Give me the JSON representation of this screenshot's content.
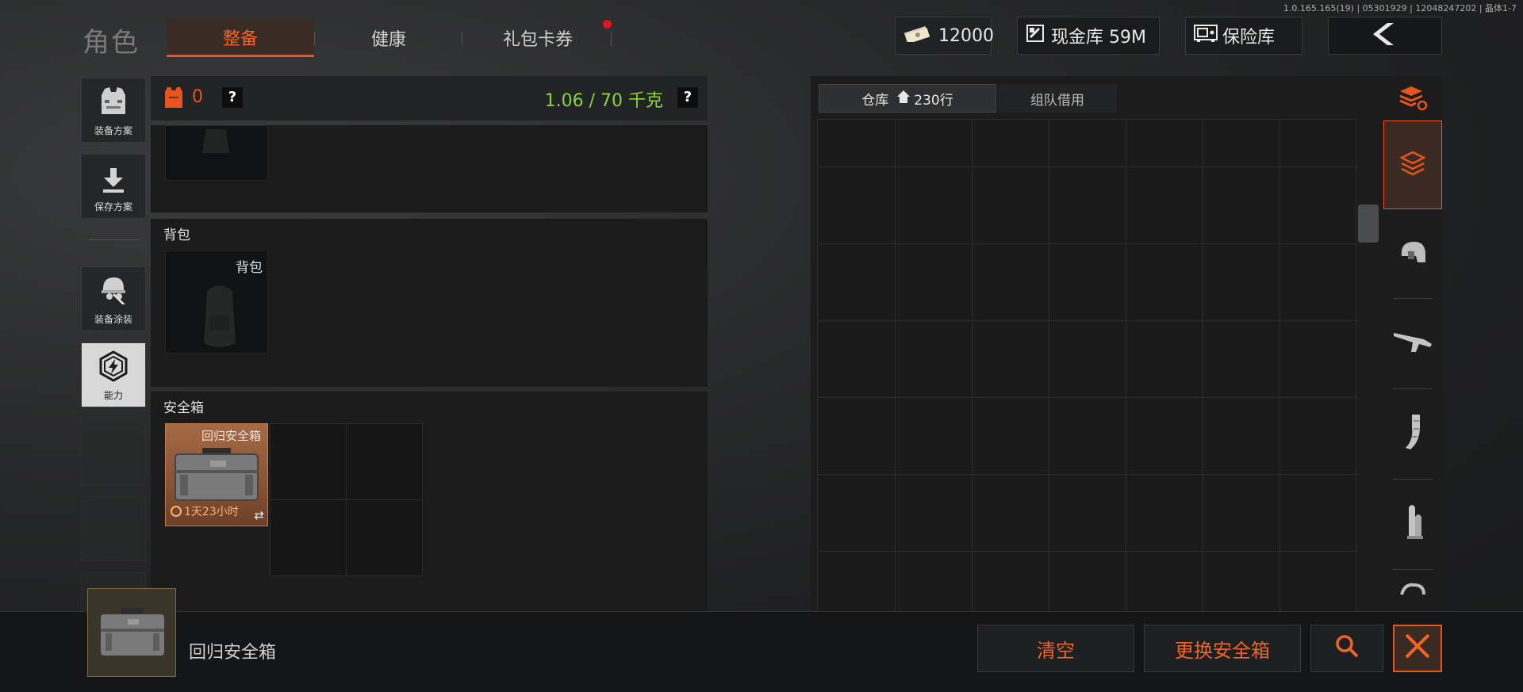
{
  "version": "1.0.165.165(19) | 05301929 | 12048247202 | 晶体1-7",
  "header": {
    "title": "角色",
    "tabs": [
      {
        "label": "整备",
        "active": true
      },
      {
        "label": "健康",
        "active": false
      },
      {
        "label": "礼包卡券",
        "active": false,
        "notification": true
      }
    ],
    "currency": {
      "icon": "cash-icon",
      "value": "12000"
    },
    "cash_vault": {
      "icon": "vault-icon",
      "label": "现金库 59M"
    },
    "safe_vault": {
      "icon": "safe-icon",
      "label": "保险库"
    },
    "back_icon": "chevron-left-icon"
  },
  "sidebar": {
    "items": [
      {
        "label": "装备方案",
        "icon": "vest-icon"
      },
      {
        "label": "保存方案",
        "icon": "download-icon"
      },
      {
        "label": "装备涂装",
        "icon": "helmet-paint-icon"
      },
      {
        "label": "能力",
        "icon": "ability-icon",
        "selected": true
      }
    ]
  },
  "loadout": {
    "armor_count": "0",
    "help_label": "?",
    "weight": "1.06 / 70 千克",
    "backpack": {
      "section_title": "背包",
      "slot_label": "背包"
    },
    "safebox": {
      "section_title": "安全箱",
      "item_name": "回归安全箱",
      "timer": "1天23小时"
    }
  },
  "warehouse": {
    "tabs": [
      {
        "label": "仓库",
        "icon": "home-icon",
        "rows": "230行",
        "active": true
      },
      {
        "label": "组队借用",
        "active": false
      }
    ],
    "categories": [
      "stack-refresh-icon",
      "layers-icon",
      "helmet-icon",
      "rifle-icon",
      "magazine-icon",
      "ammo-icon",
      "misc-icon"
    ]
  },
  "bottom": {
    "item_name": "回归安全箱",
    "clear_label": "清空",
    "replace_label": "更换安全箱",
    "search_icon": "search-icon",
    "close_icon": "close-icon"
  },
  "colors": {
    "accent": "#e8541c",
    "weight_green": "#8bd43a",
    "safebox_bg": "#8a5436"
  }
}
